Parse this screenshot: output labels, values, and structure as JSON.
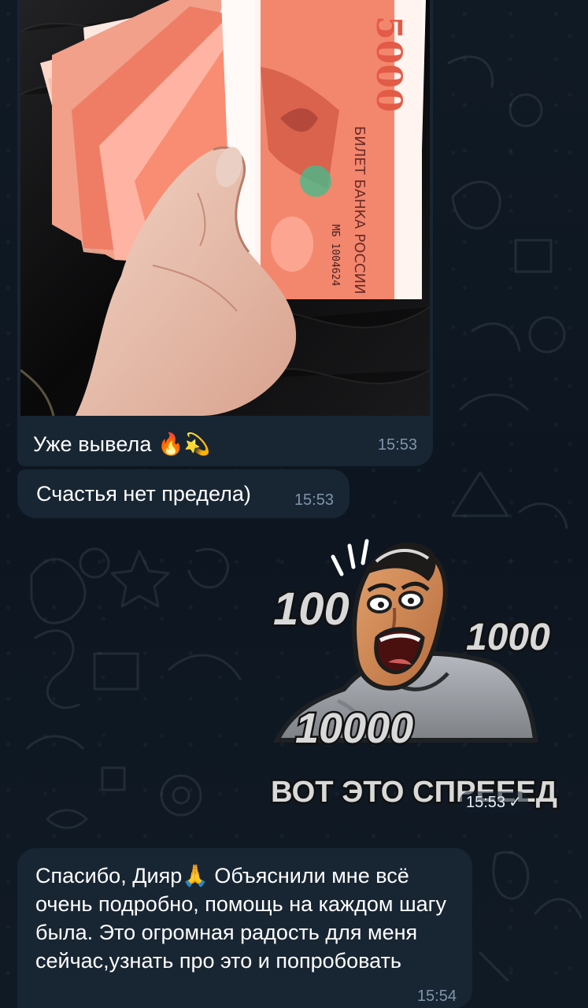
{
  "messages": [
    {
      "text": "Уже вывела 🔥💫",
      "time": "15:53"
    },
    {
      "text": "Счастья нет предела)",
      "time": "15:53"
    },
    {
      "time": "15:53",
      "status": "read"
    },
    {
      "text": "Спасибо, Дияр🙏 Объяснили мне всё очень подробно, помощь на каждом шагу была. Это огромная радость для меня сейчас,узнать про это и попробовать",
      "time": "15:54"
    }
  ],
  "sticker": {
    "top_text": "100",
    "right_text": "1000",
    "bottom_left_text": "10000",
    "caption": "ВОТ ЭТО СПРЕЕЕД"
  },
  "photo": {
    "banknote_text": "БИЛЕТ БАНКА РОССИИ",
    "banknote_value": "5000",
    "serial": "МБ 1004624"
  }
}
